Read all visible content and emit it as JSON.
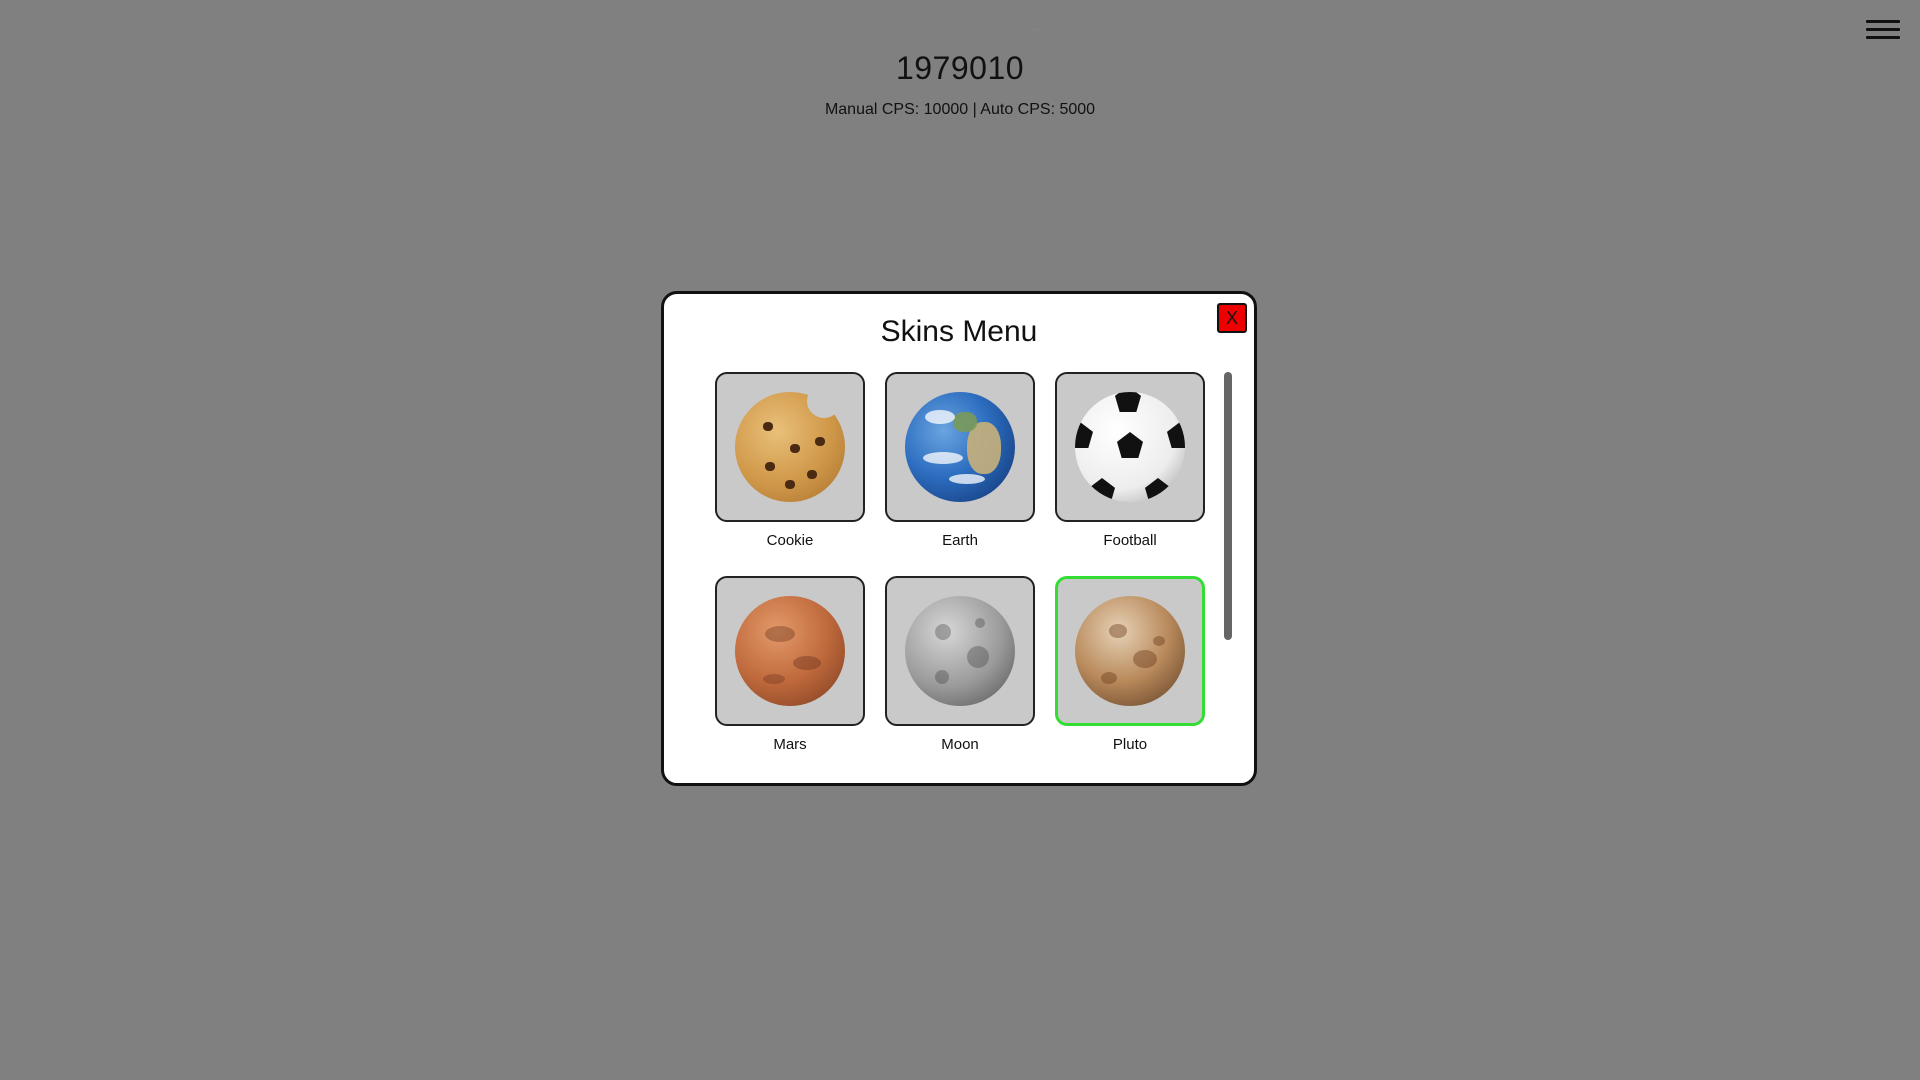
{
  "header": {
    "score": "1979010",
    "cps_text": "Manual CPS: 10000 | Auto CPS: 5000",
    "faint_text": "···"
  },
  "icons": {
    "menu": "hamburger-menu-icon",
    "close": "close-icon"
  },
  "modal": {
    "title": "Skins Menu",
    "close_label": "X",
    "skins": [
      {
        "label": "Cookie",
        "icon": "cookie-icon",
        "selected": false
      },
      {
        "label": "Earth",
        "icon": "earth-icon",
        "selected": false
      },
      {
        "label": "Football",
        "icon": "football-icon",
        "selected": false
      },
      {
        "label": "Mars",
        "icon": "mars-icon",
        "selected": false
      },
      {
        "label": "Moon",
        "icon": "moon-icon",
        "selected": false
      },
      {
        "label": "Pluto",
        "icon": "pluto-icon",
        "selected": true
      }
    ]
  },
  "colors": {
    "background": "#808080",
    "modal_bg": "#ffffff",
    "close_button": "#ee0000",
    "selected_border": "#33dd33",
    "tile_bg": "#c9c9c9"
  }
}
